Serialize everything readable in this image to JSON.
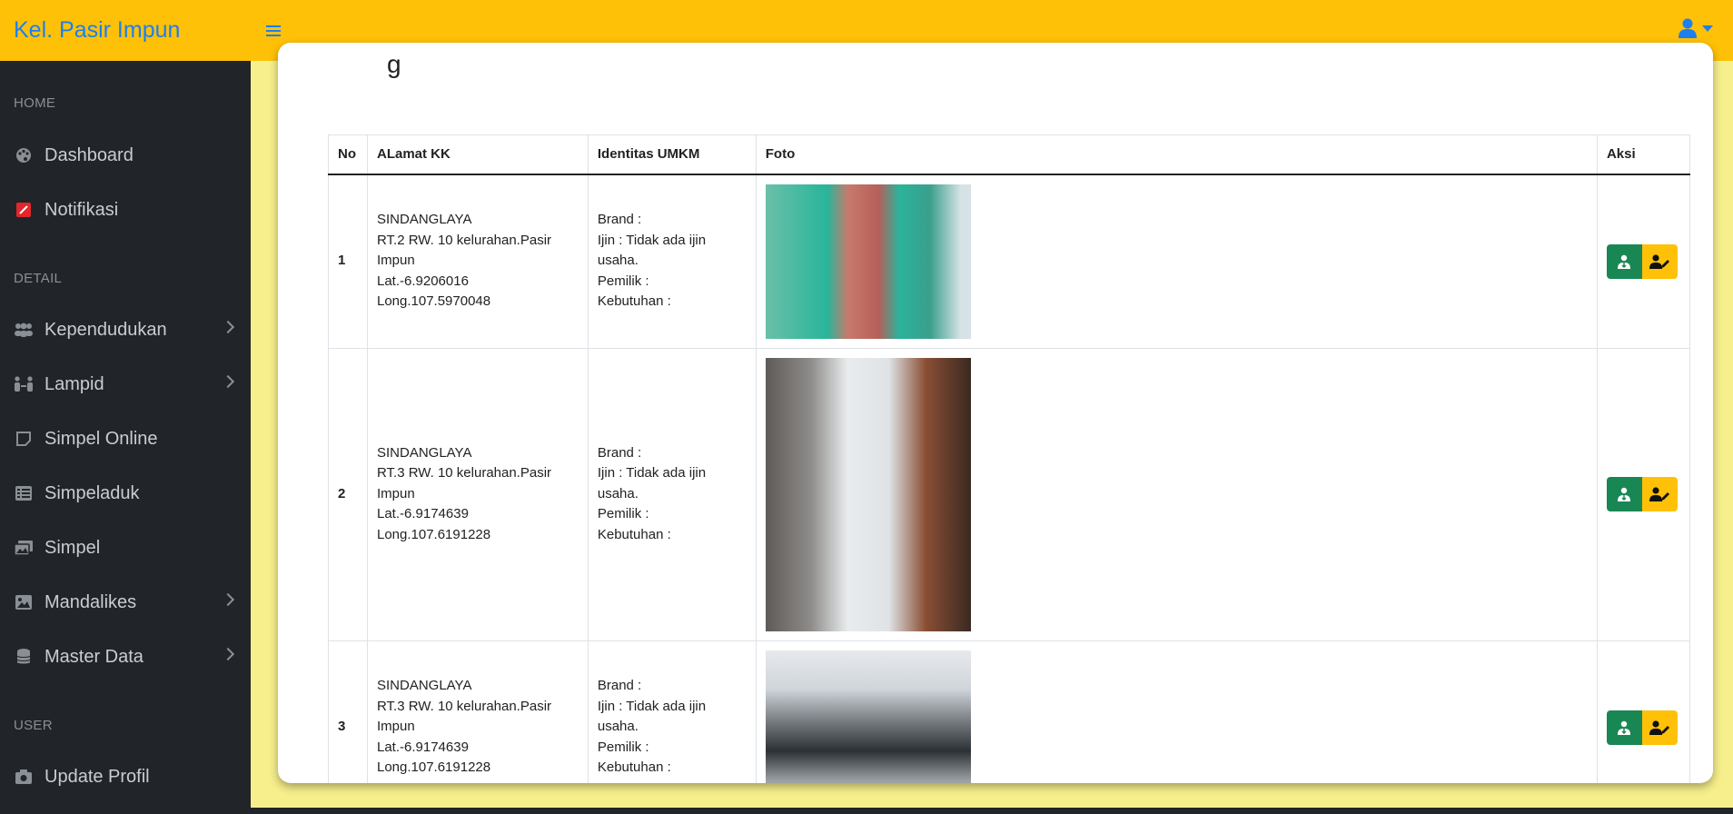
{
  "navbar": {
    "brand": "Kel. Pasir Impun",
    "colors": {
      "bg": "#ffc107",
      "accent": "#1d7ff0"
    }
  },
  "sidebar": {
    "headings": {
      "home": "HOME",
      "detail": "DETAIL",
      "user": "USER"
    },
    "items": [
      {
        "label": "Dashboard",
        "icon": "palette-icon"
      },
      {
        "label": "Notifikasi",
        "icon": "notification-icon"
      },
      {
        "label": "Kependudukan",
        "icon": "users-icon"
      },
      {
        "label": "Lampid",
        "icon": "people-arrows-icon"
      },
      {
        "label": "Simpel Online",
        "icon": "note-icon"
      },
      {
        "label": "Simpeladuk",
        "icon": "list-icon"
      },
      {
        "label": "Simpel",
        "icon": "images-icon"
      },
      {
        "label": "Mandalikes",
        "icon": "image-icon"
      },
      {
        "label": "Master Data",
        "icon": "database-icon"
      },
      {
        "label": "Update Profil",
        "icon": "camera-icon"
      }
    ]
  },
  "card": {
    "title_fragment": "g"
  },
  "table": {
    "headers": [
      "No",
      "ALamat KK",
      "Identitas UMKM",
      "Foto",
      "Aksi"
    ],
    "rows": [
      {
        "no": "1",
        "alamat": [
          "SINDANGLAYA",
          "RT.2 RW. 10 kelurahan.Pasir",
          "Impun",
          "Lat.-6.9206016",
          "Long.107.5970048"
        ],
        "identitas": [
          "Brand :",
          "Ijin : Tidak ada ijin",
          "usaha.",
          "Pemilik :",
          "Kebutuhan :"
        ]
      },
      {
        "no": "2",
        "alamat": [
          "SINDANGLAYA",
          "RT.3 RW. 10 kelurahan.Pasir",
          "Impun",
          "Lat.-6.9174639",
          "Long.107.6191228"
        ],
        "identitas": [
          "Brand :",
          "Ijin : Tidak ada ijin",
          "usaha.",
          "Pemilik :",
          "Kebutuhan :"
        ]
      },
      {
        "no": "3",
        "alamat": [
          "SINDANGLAYA",
          "RT.3 RW. 10 kelurahan.Pasir",
          "Impun",
          "Lat.-6.9174639",
          "Long.107.6191228"
        ],
        "identitas": [
          "Brand :",
          "Ijin : Tidak ada ijin",
          "usaha.",
          "Pemilik :",
          "Kebutuhan :"
        ]
      }
    ],
    "action_icons": [
      "user-download-icon",
      "user-edit-icon"
    ],
    "action_colors": {
      "primary": "#198754",
      "secondary": "#ffc107"
    }
  }
}
